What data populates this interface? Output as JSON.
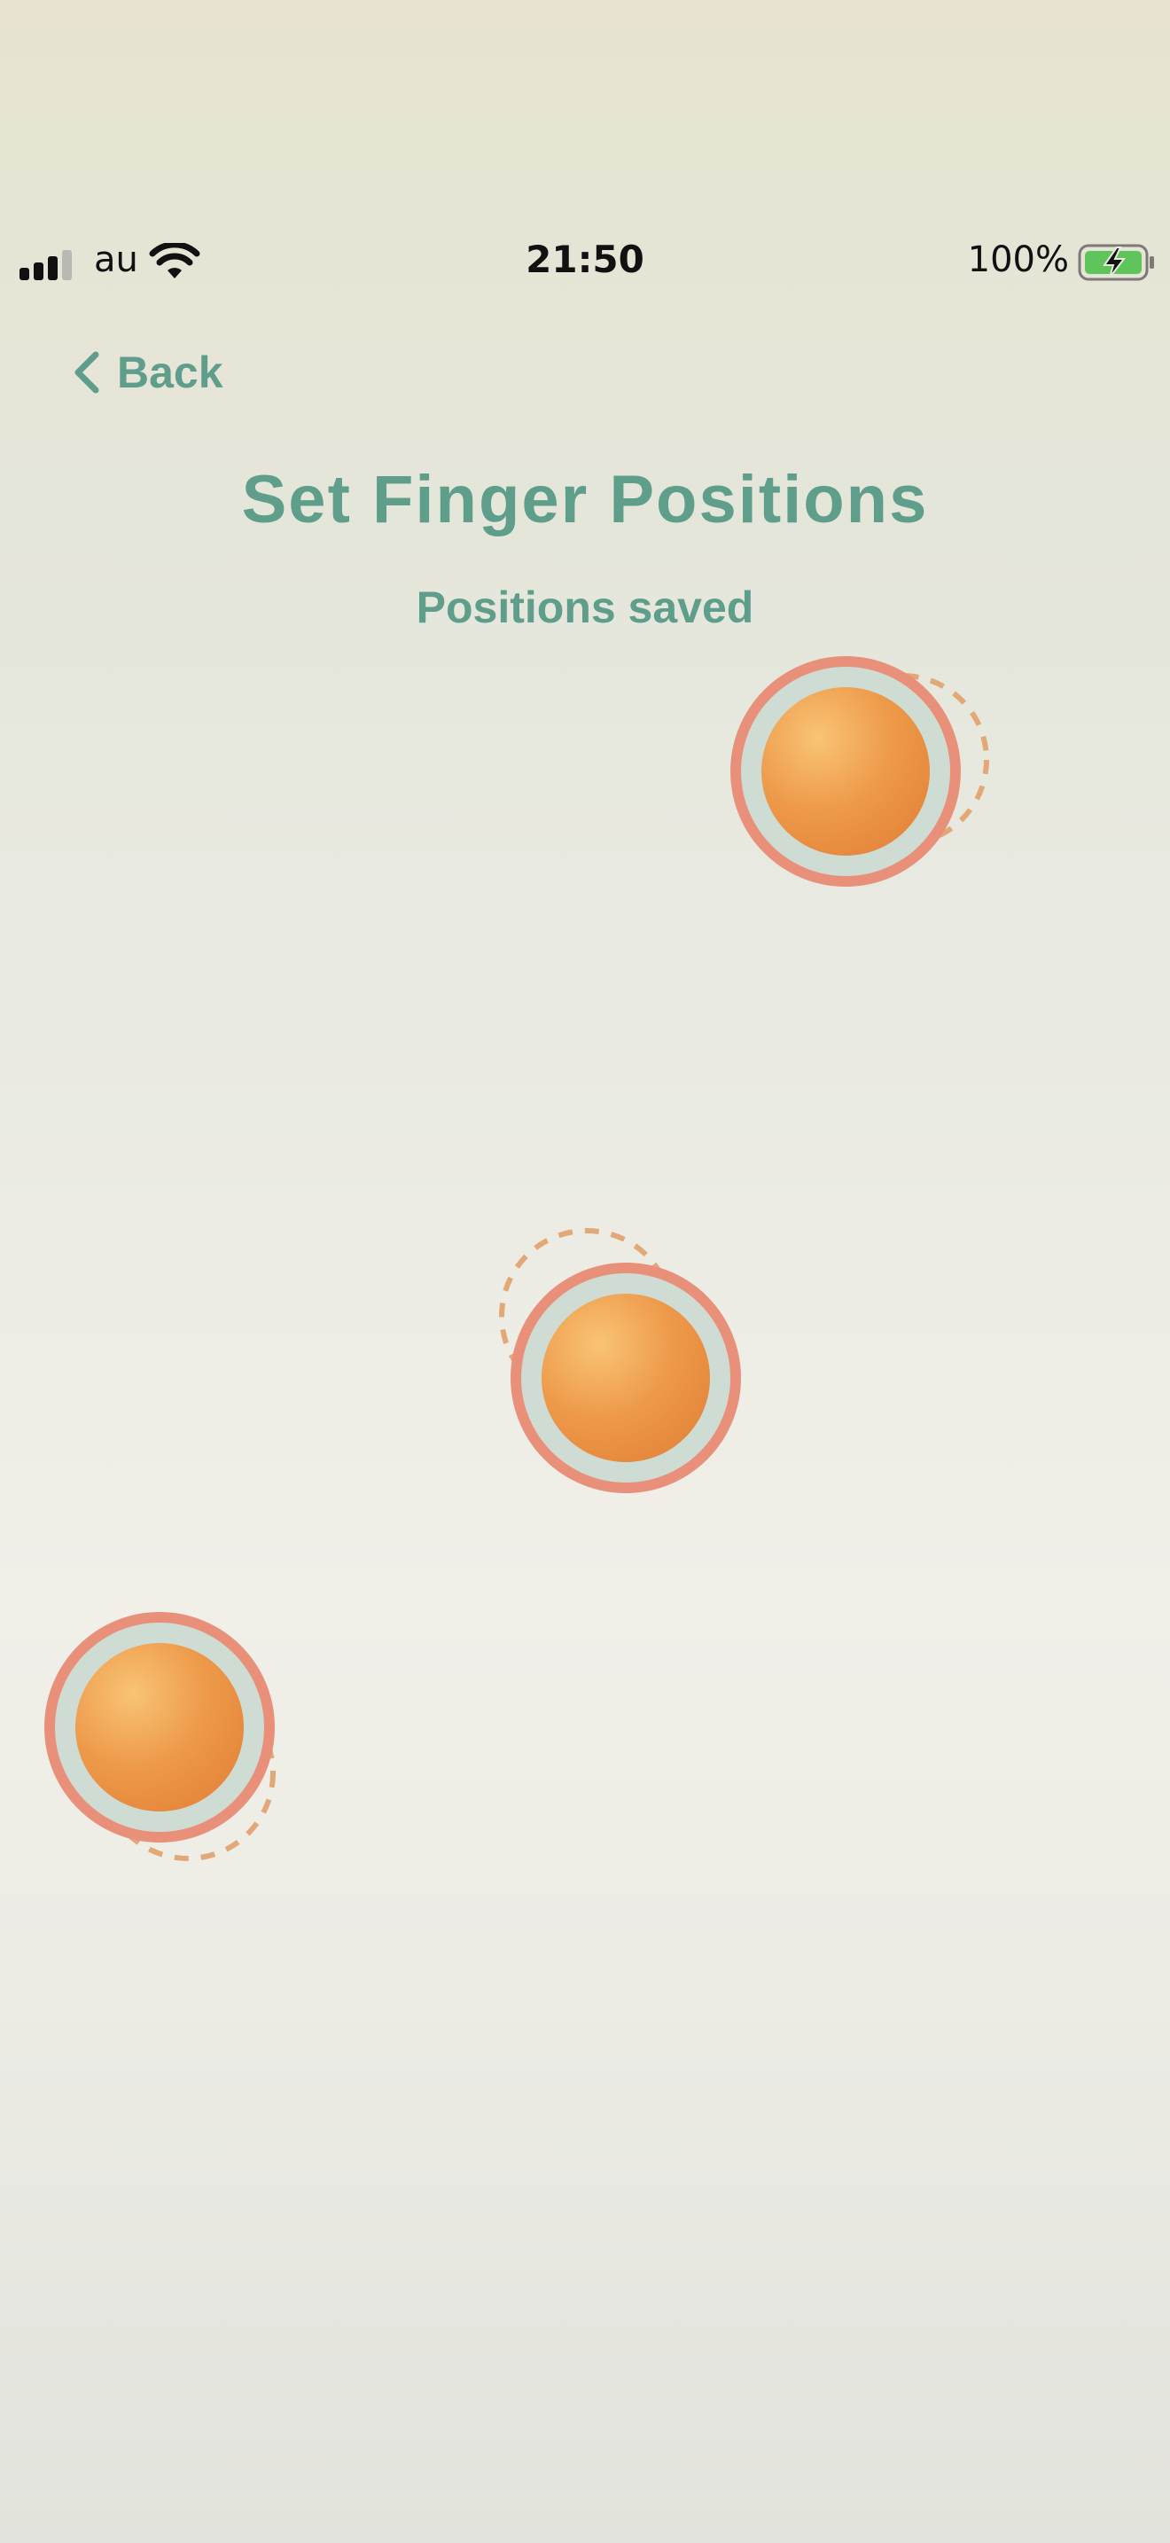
{
  "status_bar": {
    "carrier": "au",
    "time": "21:50",
    "battery_percent": "100%",
    "icons": [
      "signal-icon",
      "wifi-icon",
      "battery-charging-icon"
    ]
  },
  "nav": {
    "back_label": "Back",
    "back_icon": "chevron-left-icon"
  },
  "page": {
    "title": "Set Finger Positions",
    "status": "Positions saved"
  },
  "fingers": [
    {
      "name": "finger-marker-1"
    },
    {
      "name": "finger-marker-2"
    },
    {
      "name": "finger-marker-3"
    }
  ],
  "colors": {
    "accent": "#5f9e8b",
    "ring": "#e8907a",
    "dot": "#ee9a4b",
    "dashed_outline": "#e3a877"
  }
}
